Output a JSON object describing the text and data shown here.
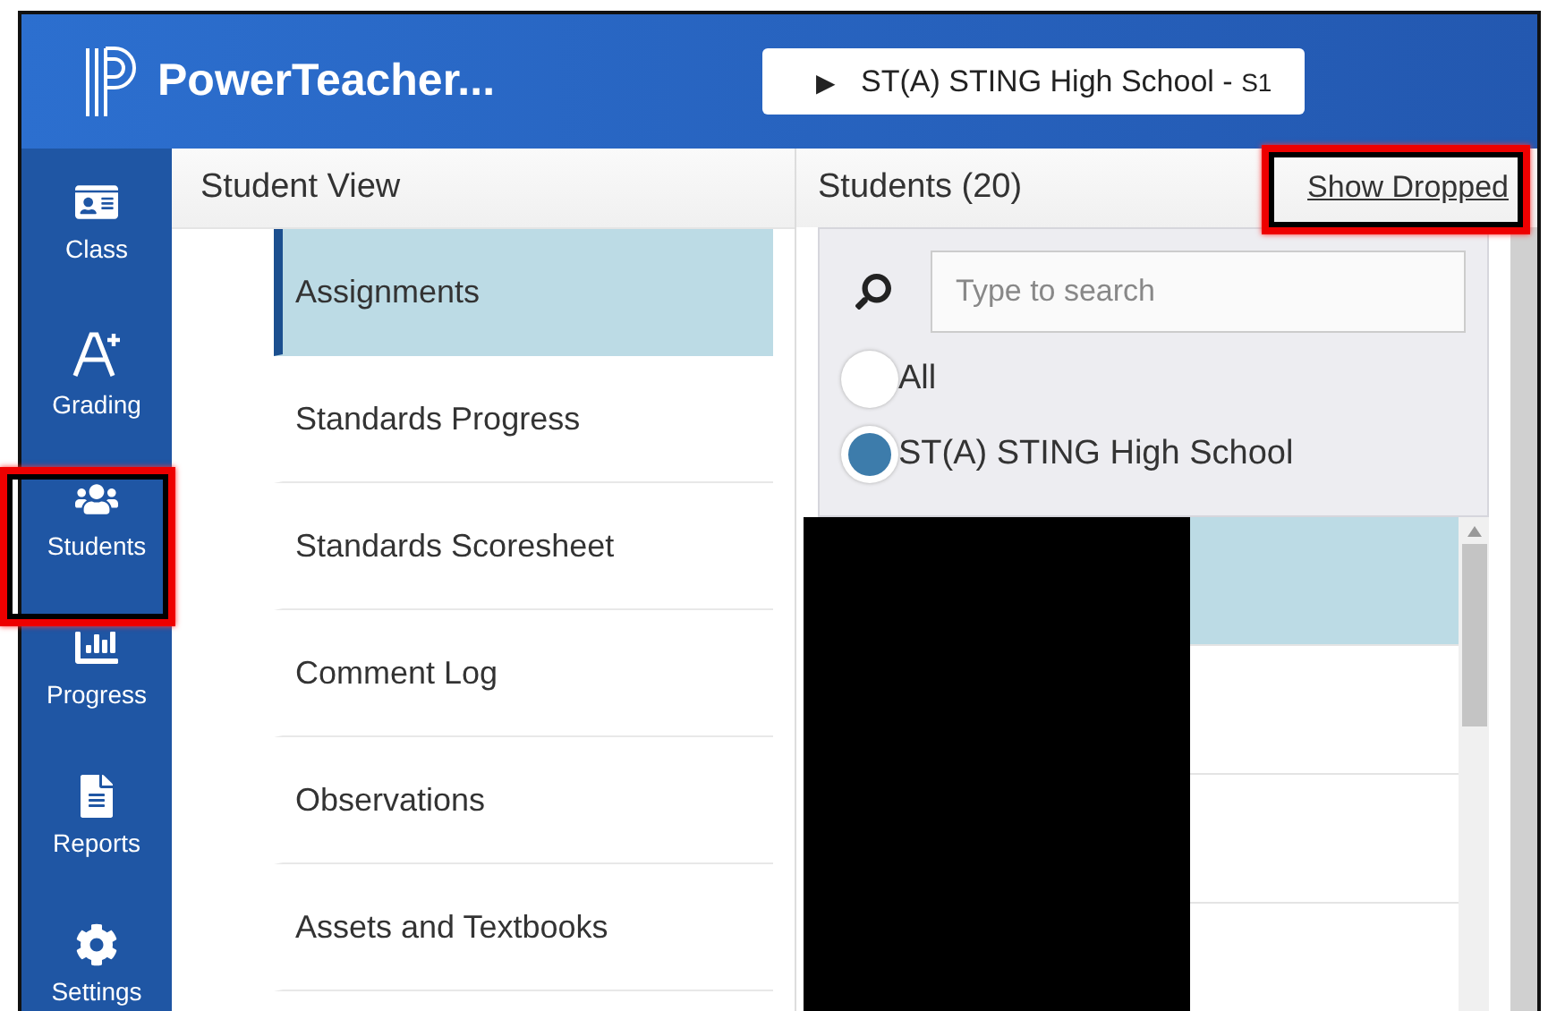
{
  "header": {
    "app_title": "PowerTeacher...",
    "class_selector": {
      "icon": "▶",
      "label": "ST(A) STING High School - ",
      "term": "S1"
    }
  },
  "nav": [
    {
      "kind": "class",
      "label": "Class",
      "annotated": false
    },
    {
      "kind": "grading",
      "label": "Grading",
      "annotated": false
    },
    {
      "kind": "students",
      "label": "Students",
      "annotated": true
    },
    {
      "kind": "progress",
      "label": "Progress",
      "annotated": false
    },
    {
      "kind": "reports",
      "label": "Reports",
      "annotated": false
    },
    {
      "kind": "settings",
      "label": "Settings",
      "annotated": false
    }
  ],
  "student_view": {
    "title": "Student View",
    "items": [
      {
        "label": "Assignments",
        "selected": true
      },
      {
        "label": "Standards Progress",
        "selected": false
      },
      {
        "label": "Standards Scoresheet",
        "selected": false
      },
      {
        "label": "Comment Log",
        "selected": false
      },
      {
        "label": "Observations",
        "selected": false
      },
      {
        "label": "Assets and Textbooks",
        "selected": false
      }
    ]
  },
  "students": {
    "title": "Students (20)",
    "show_dropped": {
      "label": "Show Dropped",
      "annotated": true
    },
    "search": {
      "placeholder": "Type to search"
    },
    "filters": [
      {
        "label": "All",
        "selected": false
      },
      {
        "label": "ST(A) STING High School",
        "selected": true
      }
    ],
    "rows": [
      {
        "selected": true
      },
      {
        "selected": false
      },
      {
        "selected": false
      }
    ],
    "redacted": true
  }
}
